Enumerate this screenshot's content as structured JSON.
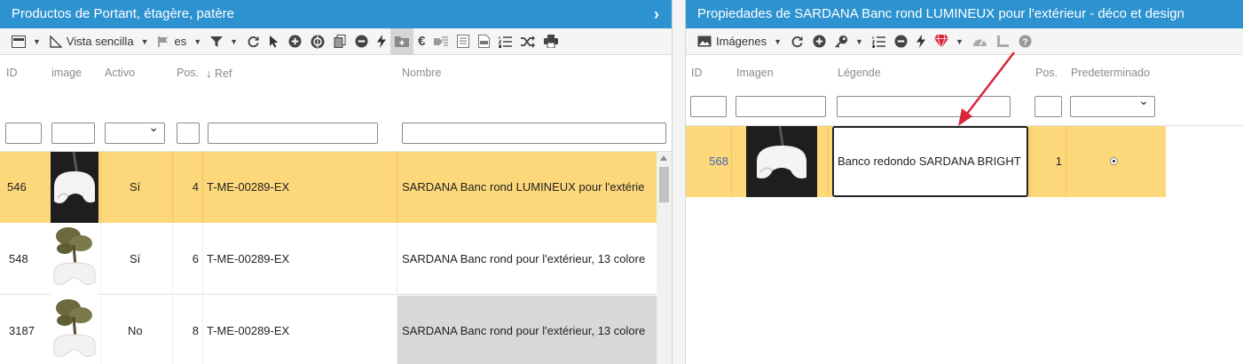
{
  "left": {
    "title": "Productos de Portant, étagère, patère",
    "toolbar": {
      "view_label": "Vista sencilla",
      "lang_label": "es"
    },
    "columns": {
      "id": "ID",
      "image": "image",
      "activo": "Activo",
      "pos": "Pos.",
      "ref": "Ref",
      "nombre": "Nombre"
    },
    "rows": [
      {
        "id": "546",
        "activo": "Sí",
        "pos": "4",
        "ref": "T-ME-00289-EX",
        "nombre": "SARDANA Banc rond LUMINEUX pour l'extérie"
      },
      {
        "id": "548",
        "activo": "Sí",
        "pos": "6",
        "ref": "T-ME-00289-EX",
        "nombre": "SARDANA Banc rond pour l'extérieur, 13 colore"
      },
      {
        "id": "3187",
        "activo": "No",
        "pos": "8",
        "ref": "T-ME-00289-EX",
        "nombre": "SARDANA Banc rond pour l'extérieur, 13 colore"
      }
    ]
  },
  "right": {
    "title": "Propiedades de SARDANA Banc rond LUMINEUX pour l'extérieur - déco et design",
    "toolbar": {
      "images_label": "Imágenes"
    },
    "columns": {
      "id": "ID",
      "imagen": "Imagen",
      "legende": "Légende",
      "pos": "Pos.",
      "predeterminado": "Predeterminado"
    },
    "rows": [
      {
        "id": "568",
        "legende": "Banco redondo SARDANA BRIGHT",
        "pos": "1"
      }
    ]
  },
  "colors": {
    "header": "#2d92d0",
    "selected_row": "#fdd87a",
    "arrow": "#d9263a",
    "link": "#3b62b8"
  }
}
